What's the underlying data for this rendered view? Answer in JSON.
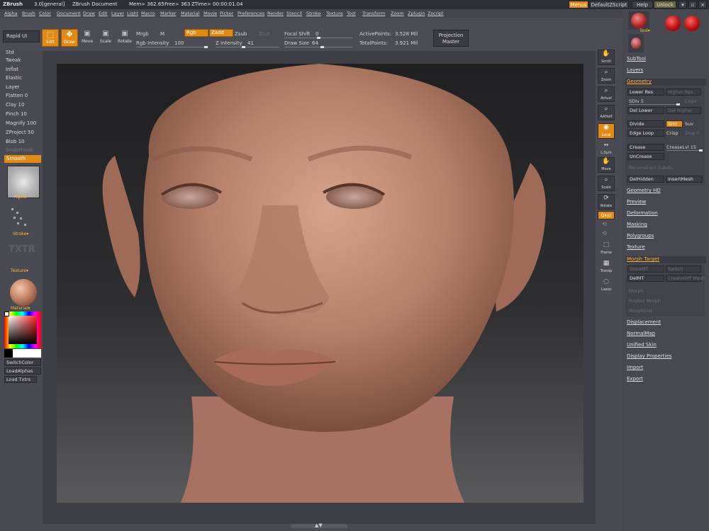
{
  "titlebar": {
    "app": "ZBrush",
    "version": "3.0[general]",
    "document": "ZBrush Document",
    "mem": "Mem> 362.65",
    "free": "Free> 363",
    "ztime": "ZTime> 00:00:01.04",
    "menus_btn": "Menus",
    "script_btn": "DefaultZScript",
    "help_btn": "Help",
    "unlock_btn": "Unlock"
  },
  "menubar": [
    "Alpha",
    "Brush",
    "Color",
    "Document",
    "Draw",
    "Edit",
    "Layer",
    "Light",
    "Macro",
    "Marker",
    "Material",
    "Movie",
    "Picker",
    "Preferences",
    "Render",
    "Stencil",
    "Stroke",
    "Texture",
    "Tool",
    "Transform",
    "Zoom",
    "Zplugin",
    "Zscript"
  ],
  "shelf": {
    "rapid_ui": "Rapid UI",
    "edit": "Edit",
    "draw": "Draw",
    "move": "Move",
    "scale": "Scale",
    "rotate": "Rotate",
    "mrgb": "Mrgb",
    "m": "M",
    "rgb": "Rgb",
    "zadd": "Zadd",
    "zsub": "Zsub",
    "zcut": "Zcut",
    "rgb_intensity_label": "Rgb Intensity",
    "rgb_intensity_value": "100",
    "z_intensity_label": "Z Intensity",
    "z_intensity_value": "41",
    "focal_shift_label": "Focal Shift",
    "focal_shift_value": "0",
    "draw_size_label": "Draw Size",
    "draw_size_value": "64",
    "active_points_label": "ActivePoints:",
    "active_points_value": "3.528 Mil",
    "total_points_label": "TotalPoints:",
    "total_points_value": "3.921 Mil",
    "projection_master_1": "Projection",
    "projection_master_2": "Master"
  },
  "left": {
    "brushes": [
      {
        "name": "Std",
        "value": ""
      },
      {
        "name": "Tweak",
        "value": ""
      },
      {
        "name": "Inflat",
        "value": ""
      },
      {
        "name": "Elastic",
        "value": ""
      },
      {
        "name": "Layer",
        "value": ""
      },
      {
        "name": "Flatten",
        "value": "0"
      },
      {
        "name": "Clay",
        "value": "10"
      },
      {
        "name": "Pinch",
        "value": "10"
      },
      {
        "name": "Magnify",
        "value": "100"
      },
      {
        "name": "ZProject",
        "value": "50"
      },
      {
        "name": "Blob",
        "value": "10"
      },
      {
        "name": "Snakehook",
        "value": ""
      }
    ],
    "smooth": "Smooth",
    "alpha_label": "Alpha",
    "stroke_label": "Stroke",
    "texture_placeholder": "TXTR",
    "texture_label": "Texture",
    "material_label": "Material",
    "switch_color": "SwitchColor",
    "load_alphas": "LoadAlphas",
    "load_txtrs": "Load Txtrs"
  },
  "rightstrip": [
    "Scroll",
    "Zoom",
    "Actual",
    "AAHalf",
    "Local",
    "L.Sym",
    "Move",
    "Scale",
    "Rotate",
    "Qxyz",
    "Frame",
    "Transp",
    "Lasso"
  ],
  "rightpanel": {
    "tool_label": "Tool",
    "subtool": "SubTool",
    "layers": "Layers",
    "geometry": "Geometry",
    "lower_res": "Lower Res",
    "higher_res": "Higher Res",
    "sdiv_label": "SDiv",
    "sdiv_value": "5",
    "cage": "Cage",
    "del_lower": "Del Lower",
    "del_higher": "Del Higher",
    "divide": "Divide",
    "smt": "Smt",
    "suv": "Suv",
    "edge_loop": "Edge Loop",
    "crisp": "Crisp",
    "disp_label": "Disp",
    "disp_value": "0",
    "crease": "Crease",
    "creaselvl_label": "CreaseLvl",
    "creaselvl_value": "15",
    "uncrease": "UnCrease",
    "reconstruct": "Reconstruct Subdiv",
    "delhidden": "DelHidden",
    "insertmesh": "InsertMesh",
    "sections": [
      "Geometry HD",
      "Preview",
      "Deformation",
      "Masking",
      "Polygroups",
      "Texture"
    ],
    "morph_target": "Morph Target",
    "store_mt": "StoreMT",
    "switch": "Switch",
    "del_mt": "DelMT",
    "create_diff_mesh": "CreateDiff Mesh",
    "morph": "Morph",
    "project_morph": "Project Morph",
    "morph_dist": "MorphDist",
    "sections2": [
      "Displacement",
      "NormalMap",
      "Unified Skin",
      "Display Properties",
      "Import",
      "Export"
    ]
  },
  "colors": {
    "accent": "#e08b16",
    "panel": "#4a4a52",
    "skin": "#b9836e"
  }
}
